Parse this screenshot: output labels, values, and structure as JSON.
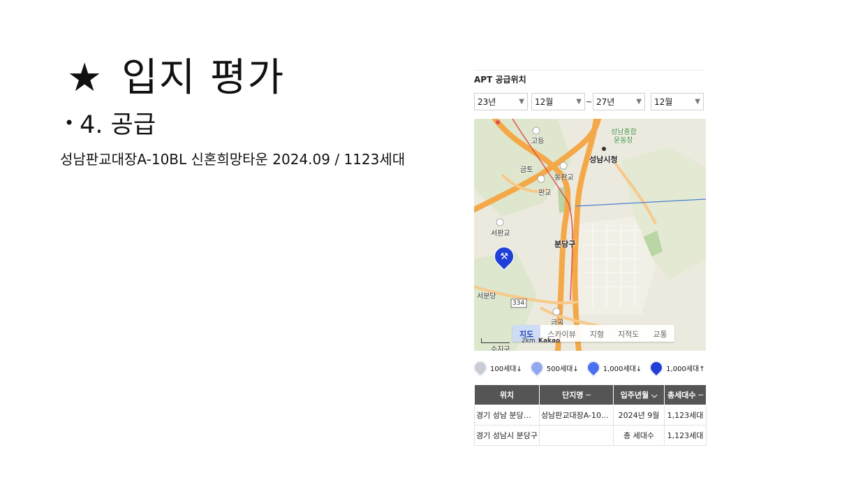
{
  "slide": {
    "title_star": "★",
    "title": "입지 평가",
    "bullet_dot": "•",
    "bullet": "4. 공급",
    "description": "성남판교대장A-10BL 신혼희망타운 2024.09 / 1123세대"
  },
  "panel": {
    "header": "APT 공급위치",
    "selects": {
      "start_year": "23년",
      "start_month": "12월",
      "separator": "~",
      "end_year": "27년",
      "end_month": "12월",
      "arrow_icon": "▼"
    },
    "map": {
      "labels": {
        "godeung": "고등",
        "seongnam_stadium_1": "성남종합",
        "seongnam_stadium_2": "운동장",
        "seongnam_cityhall": "성남시청",
        "geumto": "금토",
        "dongpangyo": "동판교",
        "pangyo": "판교",
        "seopangyo": "서판교",
        "bundanggu": "분당구",
        "seobundang": "서분당",
        "road_334": "334",
        "geumgok": "금곡",
        "sujigu": "수지구",
        "scale": "2km",
        "provider": "Kakao"
      },
      "tabs": [
        "지도",
        "스카이뷰",
        "지형",
        "지적도",
        "교통"
      ],
      "active_tab": "지도",
      "marker_icon": "hammer-icon"
    },
    "legend": [
      {
        "label": "100세대↓",
        "color": "#c8ccd6"
      },
      {
        "label": "500세대↓",
        "color": "#8fa7f0"
      },
      {
        "label": "1,000세대↓",
        "color": "#4a6ff0"
      },
      {
        "label": "1,000세대↑",
        "color": "#1f3fd6"
      }
    ],
    "table": {
      "headers": [
        "위치",
        "단지명 ─",
        "입주년월 ⌵",
        "총세대수 ─"
      ],
      "rows": [
        [
          "경기 성남 분당구...",
          "성남판교대장A-10...",
          "2024년 9월",
          "1,123세대"
        ],
        [
          "경기 성남시 분당구",
          "",
          "총 세대수",
          "1,123세대"
        ]
      ]
    }
  }
}
